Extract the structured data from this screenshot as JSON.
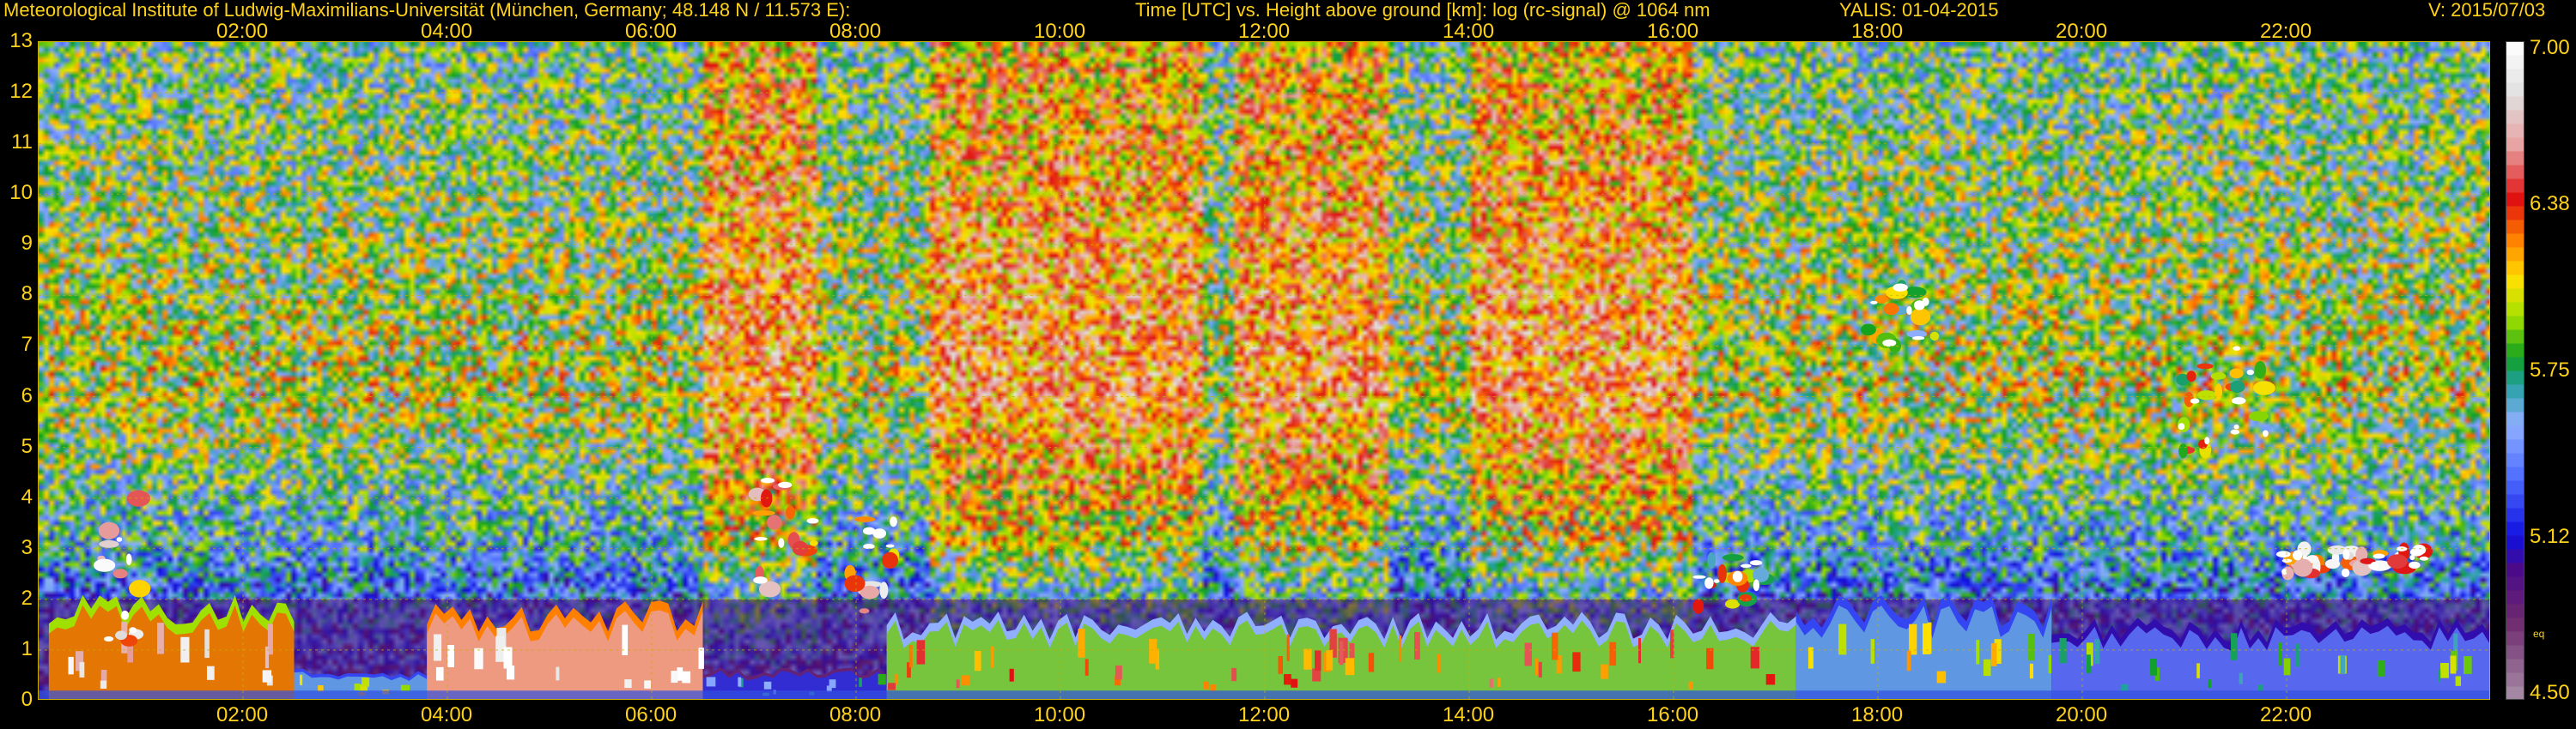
{
  "header": {
    "institute": "Meteorological Institute of Ludwig-Maximilians-Universität (München, Germany; 48.148 N / 11.573 E):",
    "description": "Time [UTC] vs. Height above ground [km]: log (rc-signal) @ 1064 nm",
    "instrument_date": "YALIS: 01-04-2015",
    "version": "V: 2015/07/03"
  },
  "colors": {
    "text": "#ffd21a",
    "grid": "#c9b000",
    "background": "#000000"
  },
  "chart_data": {
    "type": "heatmap",
    "title": "Time [UTC] vs. Height above ground [km]: log (rc-signal) @ 1064 nm",
    "xlabel": "Time [UTC]",
    "ylabel": "Height above ground [km]",
    "xlim": [
      0,
      24
    ],
    "ylim": [
      0,
      13
    ],
    "x_ticks": [
      "02:00",
      "04:00",
      "06:00",
      "08:00",
      "10:00",
      "12:00",
      "14:00",
      "16:00",
      "18:00",
      "20:00",
      "22:00"
    ],
    "x_tick_hours": [
      2,
      4,
      6,
      8,
      10,
      12,
      14,
      16,
      18,
      20,
      22
    ],
    "y_ticks": [
      "0",
      "1",
      "2",
      "3",
      "4",
      "5",
      "6",
      "7",
      "8",
      "9",
      "10",
      "11",
      "12",
      "13"
    ],
    "colorbar": {
      "range": [
        4.5,
        7.0
      ],
      "tick_labels": [
        "7.00",
        "6.38",
        "5.75",
        "5.12",
        "4.50"
      ],
      "tick_values": [
        7.0,
        6.38,
        5.75,
        5.12,
        4.5
      ],
      "small_label": "eq",
      "small_label_value": 4.75,
      "scale": [
        {
          "value": 4.5,
          "color": "#a890a8"
        },
        {
          "value": 4.8,
          "color": "#6e2a6e"
        },
        {
          "value": 5.0,
          "color": "#4a0a8a"
        },
        {
          "value": 5.12,
          "color": "#1010e0"
        },
        {
          "value": 5.35,
          "color": "#5070ff"
        },
        {
          "value": 5.55,
          "color": "#90b0ff"
        },
        {
          "value": 5.7,
          "color": "#20a0a0"
        },
        {
          "value": 5.8,
          "color": "#10a020"
        },
        {
          "value": 5.95,
          "color": "#a0e000"
        },
        {
          "value": 6.1,
          "color": "#ffe000"
        },
        {
          "value": 6.25,
          "color": "#ff8000"
        },
        {
          "value": 6.4,
          "color": "#e01010"
        },
        {
          "value": 6.6,
          "color": "#e8a0a0"
        },
        {
          "value": 6.8,
          "color": "#e0e0e0"
        },
        {
          "value": 7.0,
          "color": "#ffffff"
        }
      ]
    },
    "features": {
      "boundary_layer": [
        {
          "start_h": 0.1,
          "end_h": 2.5,
          "top_km": 1.9,
          "value": 6.3
        },
        {
          "start_h": 2.5,
          "end_h": 3.8,
          "top_km": 0.6,
          "value": 5.6
        },
        {
          "start_h": 3.8,
          "end_h": 6.5,
          "top_km": 1.8,
          "value": 6.6
        },
        {
          "start_h": 6.5,
          "end_h": 8.3,
          "top_km": 0.6,
          "value": 5.2
        },
        {
          "start_h": 8.3,
          "end_h": 17.2,
          "top_km": 1.6,
          "value": 5.9
        },
        {
          "start_h": 17.2,
          "end_h": 19.7,
          "top_km": 1.9,
          "value": 5.6
        },
        {
          "start_h": 19.7,
          "end_h": 24.0,
          "top_km": 1.5,
          "value": 5.4
        }
      ],
      "residual_layer_top_km": 2.0,
      "clouds": [
        {
          "start_h": 0.5,
          "end_h": 1.0,
          "base_km": 1.0,
          "top_km": 4.0,
          "value": 7.0
        },
        {
          "start_h": 7.0,
          "end_h": 7.6,
          "base_km": 2.2,
          "top_km": 4.4,
          "value": 6.8
        },
        {
          "start_h": 7.9,
          "end_h": 8.4,
          "base_km": 1.6,
          "top_km": 3.8,
          "value": 6.9
        },
        {
          "start_h": 16.2,
          "end_h": 16.9,
          "base_km": 1.8,
          "top_km": 3.0,
          "value": 6.5
        },
        {
          "start_h": 17.9,
          "end_h": 18.6,
          "base_km": 7.0,
          "top_km": 8.4,
          "value": 6.4
        },
        {
          "start_h": 20.9,
          "end_h": 21.8,
          "base_km": 4.9,
          "top_km": 7.0,
          "value": 6.5
        },
        {
          "start_h": 21.9,
          "end_h": 23.4,
          "base_km": 2.5,
          "top_km": 3.0,
          "value": 7.0
        }
      ],
      "noise_columns_h": [
        [
          6.5,
          7.6
        ],
        [
          8.7,
          11.4
        ],
        [
          11.7,
          13.2
        ],
        [
          14.0,
          16.2
        ]
      ]
    }
  }
}
